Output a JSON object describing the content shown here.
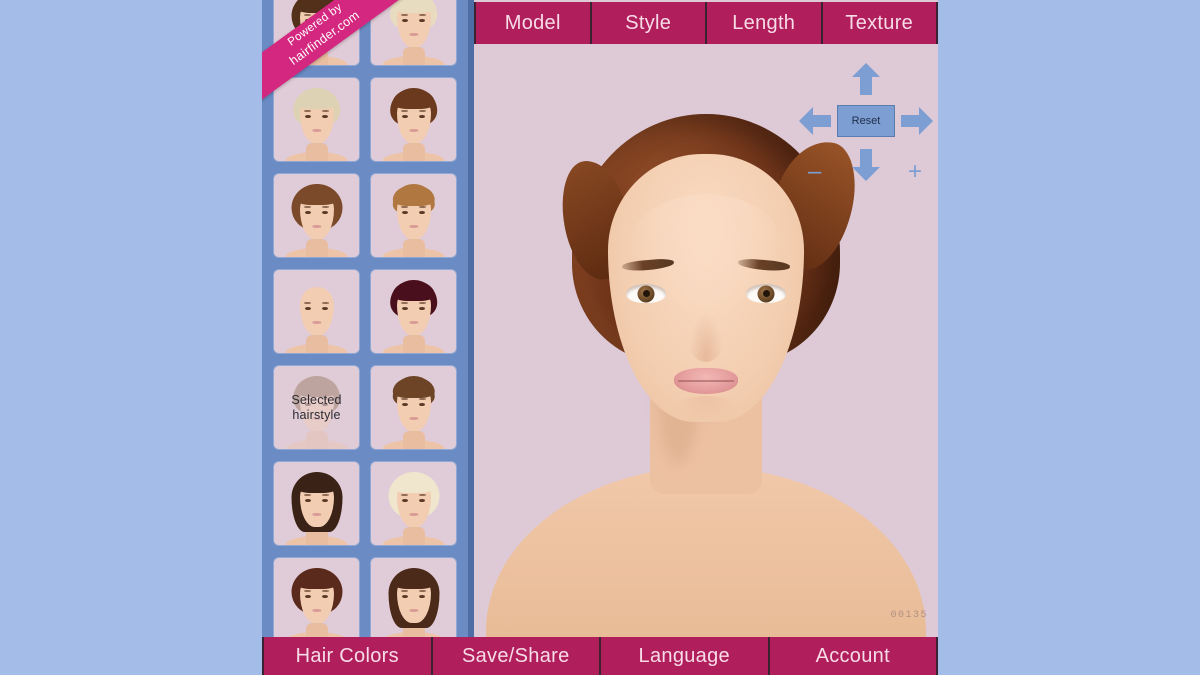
{
  "theme": {
    "page_background": "#a3bce8",
    "frame_blue": "#6b8bc4",
    "divider_blue": "#4f6da5",
    "accent_magenta": "#b01f5c",
    "stage_pink": "#dec9d7",
    "ribbon_pink": "#d4277f",
    "control_blue": "#7d9ed2"
  },
  "ribbon": {
    "line1": "Powered by",
    "line2": "hairfinder.com"
  },
  "top_tabs": [
    {
      "label": "Model"
    },
    {
      "label": "Style"
    },
    {
      "label": "Length"
    },
    {
      "label": "Texture"
    }
  ],
  "bottom_tabs": [
    {
      "label": "Hair Colors"
    },
    {
      "label": "Save/Share"
    },
    {
      "label": "Language"
    },
    {
      "label": "Account"
    }
  ],
  "controls": {
    "reset_label": "Reset",
    "arrow_up": "arrow-up-icon",
    "arrow_down": "arrow-down-icon",
    "arrow_left": "arrow-left-icon",
    "arrow_right": "arrow-right-icon",
    "zoom_out_label": "–",
    "zoom_in_label": "+"
  },
  "main_preview": {
    "image_code": "00135",
    "hair_color": "#6d3319",
    "hair_description": "short swept-back auburn pixie",
    "skin_tone": "#f3cdaf"
  },
  "thumbnails": [
    {
      "id": 1,
      "selected": false,
      "hair_color": "#53301a",
      "shape": "bob",
      "label": ""
    },
    {
      "id": 2,
      "selected": false,
      "hair_color": "#e8dcc0",
      "shape": "pixie",
      "label": ""
    },
    {
      "id": 3,
      "selected": false,
      "hair_color": "#ddd2b4",
      "shape": "pixie",
      "label": ""
    },
    {
      "id": 4,
      "selected": false,
      "hair_color": "#6b3a1e",
      "shape": "pixie",
      "label": ""
    },
    {
      "id": 5,
      "selected": false,
      "hair_color": "#7b4a2a",
      "shape": "bob",
      "label": ""
    },
    {
      "id": 6,
      "selected": false,
      "hair_color": "#b07840",
      "shape": "up",
      "label": ""
    },
    {
      "id": 7,
      "selected": false,
      "hair_color": "#c2b municipal",
      "shape": "bob",
      "label": ""
    },
    {
      "id": 8,
      "selected": false,
      "hair_color": "#4a0f1c",
      "shape": "pixie",
      "label": ""
    },
    {
      "id": 9,
      "selected": true,
      "hair_color": "#8a6a4a",
      "shape": "pixie",
      "label": "Selected hairstyle"
    },
    {
      "id": 10,
      "selected": false,
      "hair_color": "#6d4526",
      "shape": "up",
      "label": ""
    },
    {
      "id": 11,
      "selected": false,
      "hair_color": "#3a2316",
      "shape": "long",
      "label": ""
    },
    {
      "id": 12,
      "selected": false,
      "hair_color": "#efe6cd",
      "shape": "bob",
      "label": ""
    },
    {
      "id": 13,
      "selected": false,
      "hair_color": "#5a2a1c",
      "shape": "bob",
      "label": ""
    },
    {
      "id": 14,
      "selected": false,
      "hair_color": "#4b2a1a",
      "shape": "long",
      "label": ""
    }
  ]
}
